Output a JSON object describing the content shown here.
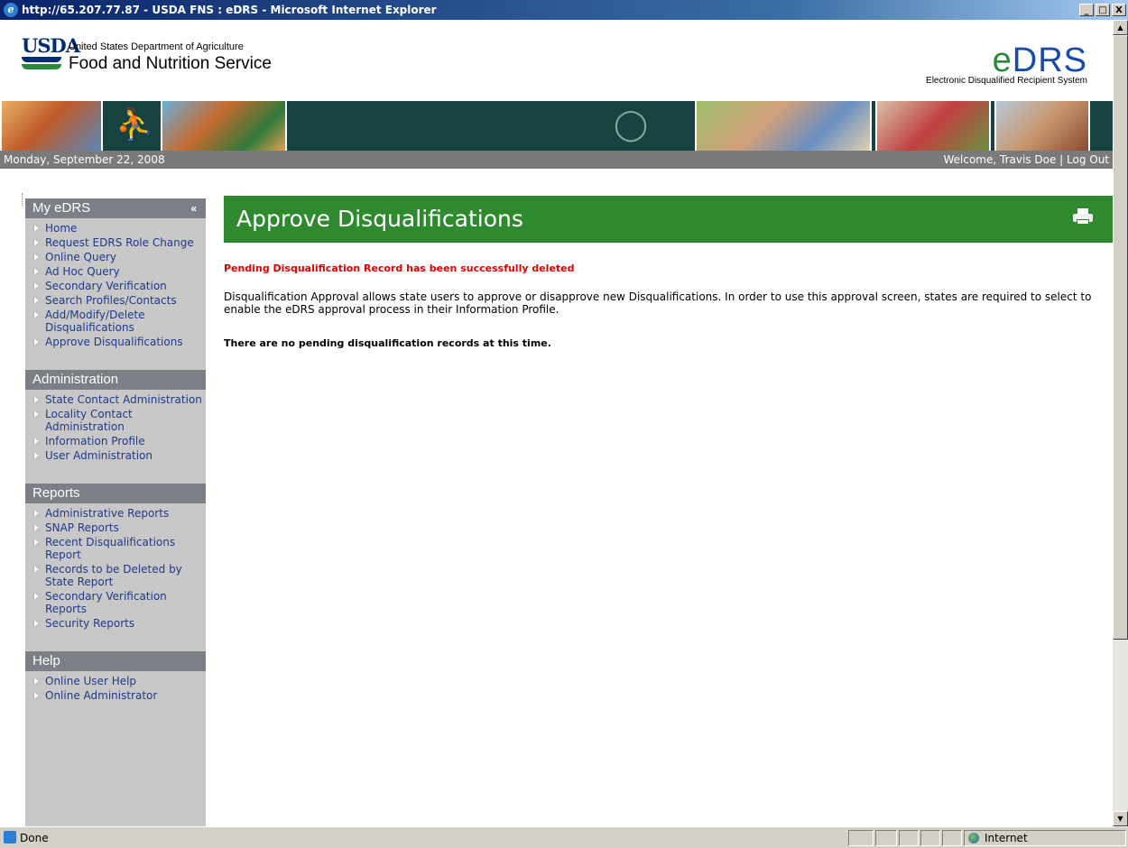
{
  "window": {
    "title": "http://65.207.77.87 - USDA FNS : eDRS - Microsoft Internet Explorer",
    "minimize": "_",
    "maximize": "□",
    "close": "X"
  },
  "header": {
    "usda_logo_text": "USDA",
    "department": "United States Department of Agriculture",
    "agency": "Food and Nutrition Service",
    "edrs_logo_e": "e",
    "edrs_logo_rest": "DRS",
    "edrs_subtitle": "Electronic Disqualified Recipient System"
  },
  "datebar": {
    "date": "Monday, September 22, 2008",
    "welcome": "Welcome, Travis Doe | Log Out"
  },
  "sidebar": {
    "sections": [
      {
        "title": "My eDRS",
        "collapse": "«",
        "items": [
          "Home",
          "Request EDRS Role Change",
          "Online Query",
          "Ad Hoc Query",
          "Secondary Verification",
          "Search Profiles/Contacts",
          "Add/Modify/Delete Disqualifications",
          "Approve Disqualifications"
        ]
      },
      {
        "title": "Administration",
        "items": [
          "State Contact Administration",
          "Locality Contact Administration",
          "Information Profile",
          "User Administration"
        ]
      },
      {
        "title": "Reports",
        "items": [
          "Administrative Reports",
          "SNAP Reports",
          "Recent Disqualifications Report",
          "Records to be Deleted by State Report",
          "Secondary Verification Reports",
          "Security Reports"
        ]
      },
      {
        "title": "Help",
        "items": [
          "Online User Help",
          "Online Administrator"
        ]
      }
    ]
  },
  "main": {
    "title": "Approve Disqualifications",
    "error_message": "Pending Disqualification Record has been successfully deleted",
    "description": "Disqualification Approval allows state users to approve or disapprove new Disqualifications. In order to use this approval screen, states are required to select to enable the eDRS approval process in their Information Profile.",
    "no_records": "There are no pending disqualification records at this time."
  },
  "statusbar": {
    "status": "Done",
    "zone": "Internet"
  },
  "colors": {
    "page_header_green": "#2f8a2f",
    "error_red": "#e00000",
    "link_blue": "#1f3a8a",
    "banner_teal": "#16423f"
  }
}
